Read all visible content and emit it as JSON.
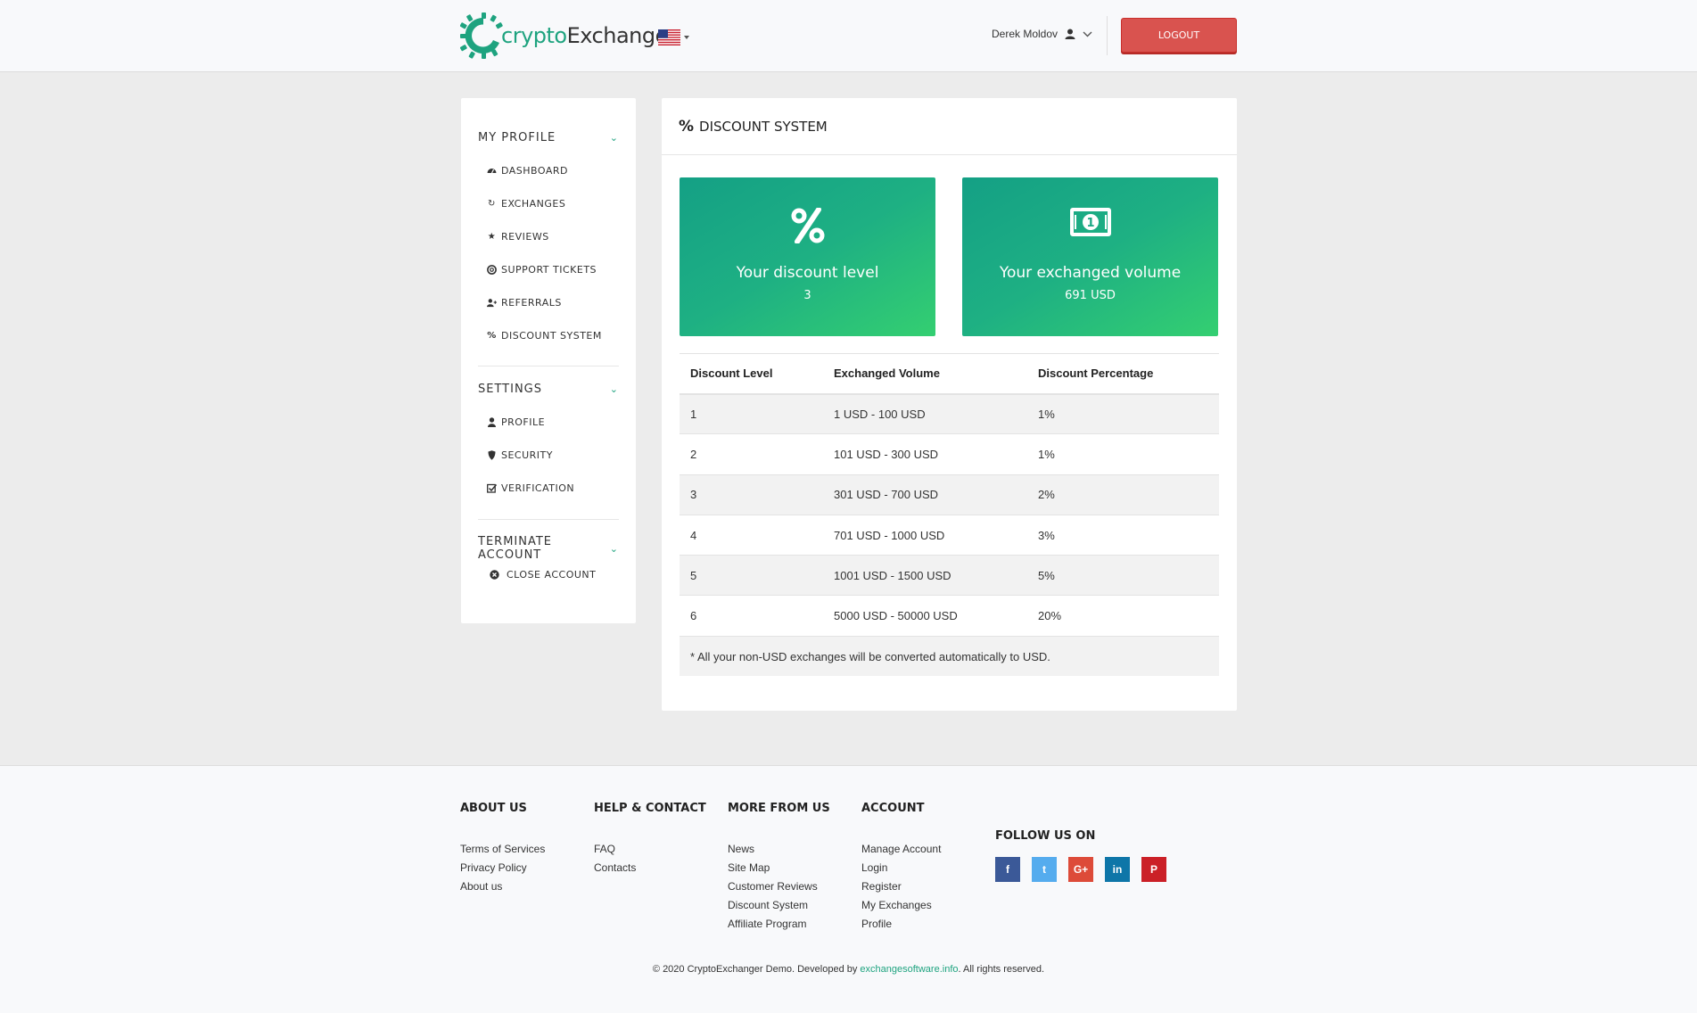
{
  "brand": {
    "name_part1": "crypto",
    "name_part2": "Exchanger",
    "accent_color": "#1ea37f"
  },
  "header": {
    "language_flag": "us-flag-icon",
    "user_name": "Derek Moldov",
    "logout_label": "LOGOUT",
    "logout_color": "#d9534f"
  },
  "sidebar": {
    "my_profile": {
      "title": "MY PROFILE",
      "items": [
        {
          "label": "DASHBOARD",
          "icon": "dashboard-icon"
        },
        {
          "label": "EXCHANGES",
          "icon": "refresh-icon"
        },
        {
          "label": "REVIEWS",
          "icon": "star-icon"
        },
        {
          "label": "SUPPORT TICKETS",
          "icon": "lifebuoy-icon"
        },
        {
          "label": "REFERRALS",
          "icon": "user-plus-icon"
        },
        {
          "label": "DISCOUNT SYSTEM",
          "icon": "percent-icon"
        }
      ]
    },
    "settings": {
      "title": "SETTINGS",
      "items": [
        {
          "label": "PROFILE",
          "icon": "user-icon"
        },
        {
          "label": "SECURITY",
          "icon": "shield-icon"
        },
        {
          "label": "VERIFICATION",
          "icon": "check-square-icon"
        }
      ]
    },
    "terminate": {
      "title": "TERMINATE ACCOUNT",
      "items": [
        {
          "label": "CLOSE ACCOUNT",
          "icon": "times-circle-icon"
        }
      ]
    }
  },
  "main": {
    "title": "DISCOUNT SYSTEM",
    "tiles": {
      "discount": {
        "title": "Your discount level",
        "value": "3",
        "icon": "percent-icon"
      },
      "volume": {
        "title": "Your exchanged volume",
        "value": "691 USD",
        "icon": "money-icon"
      }
    },
    "table": {
      "headers": [
        "Discount Level",
        "Exchanged Volume",
        "Discount Percentage"
      ],
      "rows": [
        [
          "1",
          "1 USD - 100 USD",
          "1%"
        ],
        [
          "2",
          "101 USD - 300 USD",
          "1%"
        ],
        [
          "3",
          "301 USD - 700 USD",
          "2%"
        ],
        [
          "4",
          "701 USD - 1000 USD",
          "3%"
        ],
        [
          "5",
          "1001 USD - 1500 USD",
          "5%"
        ],
        [
          "6",
          "5000 USD - 50000 USD",
          "20%"
        ]
      ],
      "note": "* All your non-USD exchanges will be converted automatically to USD."
    }
  },
  "footer": {
    "columns": [
      {
        "title": "ABOUT US",
        "links": [
          "Terms of Services",
          "Privacy Policy",
          "About us"
        ]
      },
      {
        "title": "HELP & CONTACT",
        "links": [
          "FAQ",
          "Contacts"
        ]
      },
      {
        "title": "MORE FROM US",
        "links": [
          "News",
          "Site Map",
          "Customer Reviews",
          "Discount System",
          "Affiliate Program"
        ]
      },
      {
        "title": "ACCOUNT",
        "links": [
          "Manage Account",
          "Login",
          "Register",
          "My Exchanges",
          "Profile"
        ]
      }
    ],
    "follow_title": "FOLLOW US ON",
    "socials": [
      {
        "name": "facebook-icon",
        "glyph": "f",
        "color": "#3b5998"
      },
      {
        "name": "twitter-icon",
        "glyph": "t",
        "color": "#55acee"
      },
      {
        "name": "google-plus-icon",
        "glyph": "G+",
        "color": "#dd4b39"
      },
      {
        "name": "linkedin-icon",
        "glyph": "in",
        "color": "#0e76a8"
      },
      {
        "name": "pinterest-icon",
        "glyph": "P",
        "color": "#cb2027"
      }
    ],
    "copyright_prefix": "© 2020 CryptoExchanger Demo. Developed by ",
    "copyright_link": "exchangesoftware.info",
    "copyright_suffix": ". All rights reserved."
  }
}
